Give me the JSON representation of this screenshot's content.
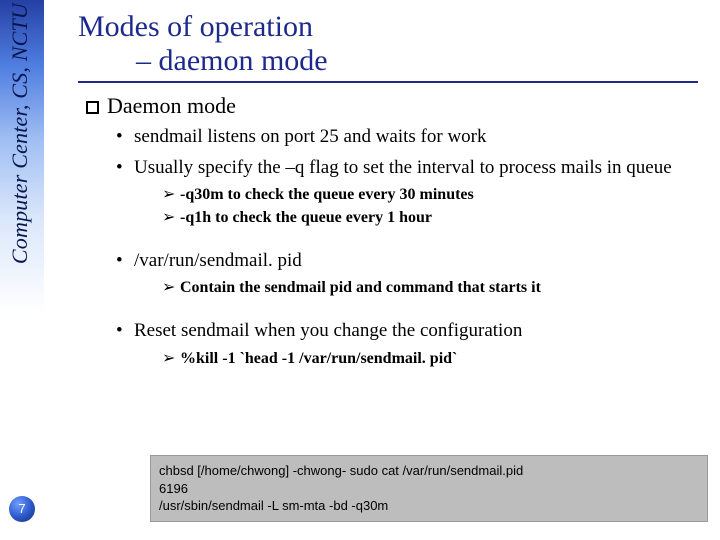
{
  "sidebar": {
    "label": "Computer Center, CS, NCTU"
  },
  "page_number": "7",
  "title": {
    "line1": "Modes of operation",
    "line2": "– daemon mode"
  },
  "section_heading": "Daemon mode",
  "bullets": {
    "b0": "sendmail listens on port 25 and waits for work",
    "b1": "Usually specify the –q flag to set the interval to process mails in queue",
    "b1_sub0": "-q30m to check the queue every 30 minutes",
    "b1_sub1": "-q1h to check the queue every 1 hour",
    "b2": "/var/run/sendmail. pid",
    "b2_sub0": "Contain the sendmail pid and command that starts it",
    "b3": "Reset sendmail when you change the configuration",
    "b3_sub0": "%kill -1 `head -1 /var/run/sendmail. pid`"
  },
  "terminal": {
    "line1": "chbsd [/home/chwong] -chwong- sudo cat /var/run/sendmail.pid",
    "line2": "6196",
    "line3": "/usr/sbin/sendmail -L sm-mta -bd -q30m"
  }
}
